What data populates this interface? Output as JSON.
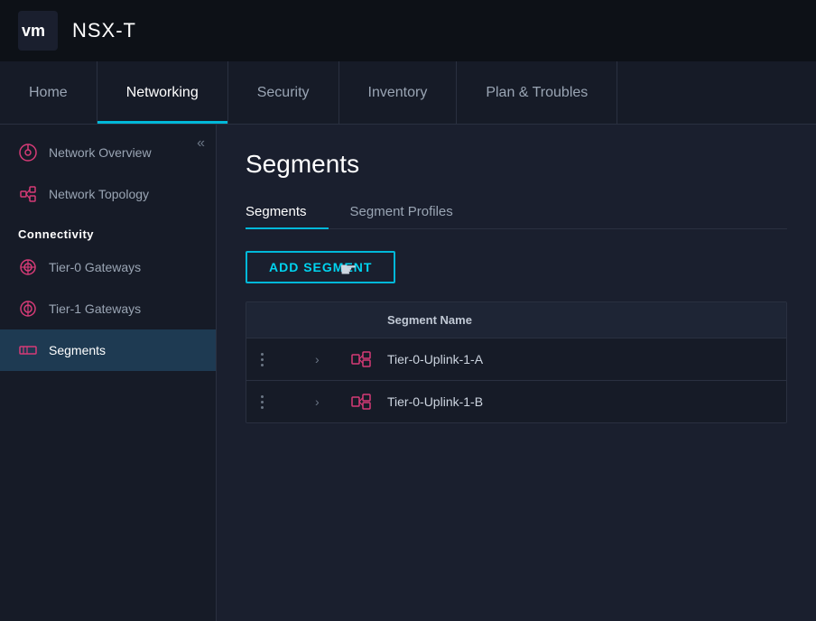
{
  "app": {
    "logo_text": "vm",
    "title": "NSX-T"
  },
  "nav": {
    "tabs": [
      {
        "id": "home",
        "label": "Home",
        "active": false
      },
      {
        "id": "networking",
        "label": "Networking",
        "active": true
      },
      {
        "id": "security",
        "label": "Security",
        "active": false
      },
      {
        "id": "inventory",
        "label": "Inventory",
        "active": false
      },
      {
        "id": "plan-troubles",
        "label": "Plan & Troubles",
        "active": false
      }
    ]
  },
  "sidebar": {
    "collapse_icon": "«",
    "items": [
      {
        "id": "network-overview",
        "label": "Network Overview",
        "icon": "network-overview"
      },
      {
        "id": "network-topology",
        "label": "Network Topology",
        "icon": "network-topology"
      }
    ],
    "section_connectivity": "Connectivity",
    "connectivity_items": [
      {
        "id": "tier0-gateways",
        "label": "Tier-0 Gateways",
        "icon": "tier0"
      },
      {
        "id": "tier1-gateways",
        "label": "Tier-1 Gateways",
        "icon": "tier1"
      },
      {
        "id": "segments",
        "label": "Segments",
        "icon": "segments",
        "active": true
      }
    ]
  },
  "content": {
    "page_title": "Segments",
    "tabs": [
      {
        "id": "segments",
        "label": "Segments",
        "active": true
      },
      {
        "id": "segment-profiles",
        "label": "Segment Profiles",
        "active": false
      }
    ],
    "add_button_label": "ADD SEGMENT",
    "table": {
      "columns": [
        {
          "id": "actions",
          "label": ""
        },
        {
          "id": "expand",
          "label": ""
        },
        {
          "id": "icon",
          "label": ""
        },
        {
          "id": "name",
          "label": "Segment Name"
        }
      ],
      "rows": [
        {
          "name": "Tier-0-Uplink-1-A"
        },
        {
          "name": "Tier-0-Uplink-1-B"
        }
      ]
    }
  },
  "colors": {
    "accent": "#00b8d9",
    "active_bg": "#1e3a52",
    "header_bg": "#0d1117",
    "sidebar_bg": "#161b27",
    "content_bg": "#1a1f2e"
  }
}
